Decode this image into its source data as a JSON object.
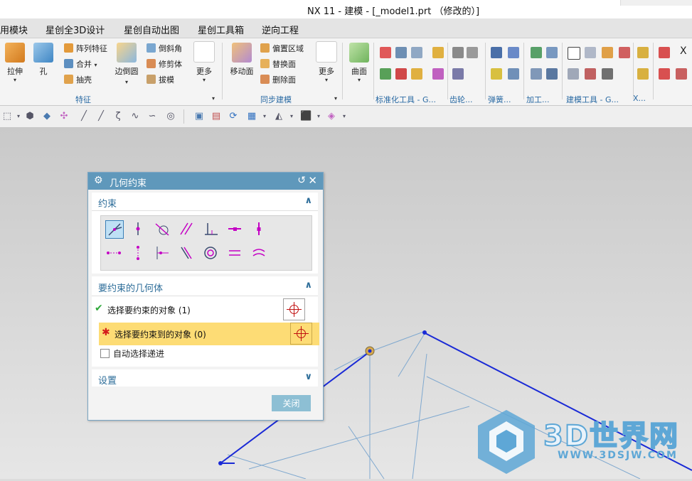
{
  "window": {
    "title": "NX 11 - 建模 - [_model1.prt （修改的）]"
  },
  "menu": {
    "items": [
      "用模块",
      "星创全3D设计",
      "星创自动出图",
      "星创工具箱",
      "逆向工程"
    ]
  },
  "ribbon": {
    "feature": {
      "extrude": "拉伸",
      "hole": "孔",
      "pattern": "阵列特征",
      "unite": "合并",
      "shell": "抽壳",
      "edge_blend": "边倒圆",
      "chamfer": "倒斜角",
      "trim_body": "修剪体",
      "draft": "拔模",
      "more": "更多",
      "group_label": "特征"
    },
    "sync": {
      "move_face": "移动面",
      "offset_region": "偏置区域",
      "replace_face": "替换面",
      "delete_face": "删除面",
      "more": "更多",
      "group_label": "同步建模"
    },
    "surface": {
      "surface": "曲面"
    },
    "groups": [
      "标准化工具 - G...",
      "齿轮...",
      "弹簧...",
      "加工...",
      "建模工具 - G...",
      "X..."
    ]
  },
  "dialog": {
    "title": "几何约束",
    "sections": {
      "constraint": "约束",
      "geometry": "要约束的几何体",
      "settings": "设置"
    },
    "select_object": "选择要约束的对象 (1)",
    "select_target": "选择要约束到的对象 (0)",
    "auto_advance": "自动选择递进",
    "close_button": "关闭"
  },
  "colors": {
    "accent": "#5f98bb",
    "highlight": "#fddc75",
    "sketch_line": "#1a2ad6",
    "dimension_line": "#7fa8cf",
    "constraint_icon": "#c400c4"
  },
  "watermark": {
    "title": "3D世界网",
    "url": "WWW.3DSJW.COM"
  }
}
